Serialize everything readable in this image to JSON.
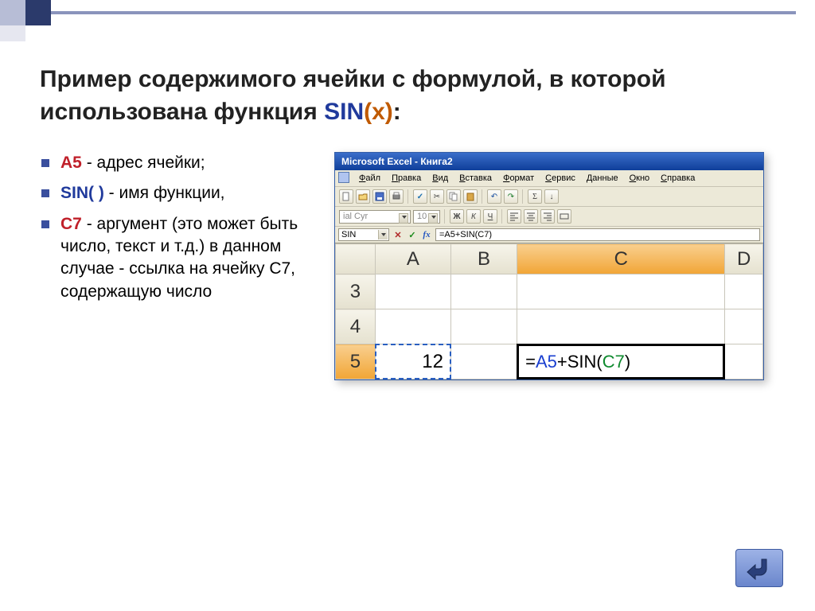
{
  "title": {
    "pre": "Пример содержимого ячейки с формулой, в которой использована функция ",
    "fn": "SIN",
    "arg": "(x)",
    "post": ":"
  },
  "bullets": [
    {
      "strong": "А5",
      "cls": "b-red",
      "text": " - адрес ячейки;"
    },
    {
      "strong": "SIN( )",
      "cls": "b-blue",
      "text": " - имя функции,"
    },
    {
      "strong": "С7",
      "cls": "b-red",
      "text": " - аргумент (это может быть число, текст и т.д.) в данном случае - ссылка на ячейку С7, содержащую число"
    }
  ],
  "excel": {
    "title": "Microsoft Excel - Книга2",
    "menu": [
      "Файл",
      "Правка",
      "Вид",
      "Вставка",
      "Формат",
      "Сервис",
      "Данные",
      "Окно",
      "Справка"
    ],
    "font": "ial Cyr",
    "size": "10",
    "styleBtns": [
      "Ж",
      "К",
      "Ч"
    ],
    "name": "SIN",
    "fx": "=A5+SIN(C7)",
    "cols": [
      "A",
      "B",
      "C",
      "D"
    ],
    "rows": [
      "3",
      "4",
      "5"
    ],
    "a5": "12",
    "formula": {
      "ref1": "A5",
      "ref2": "C7"
    }
  }
}
